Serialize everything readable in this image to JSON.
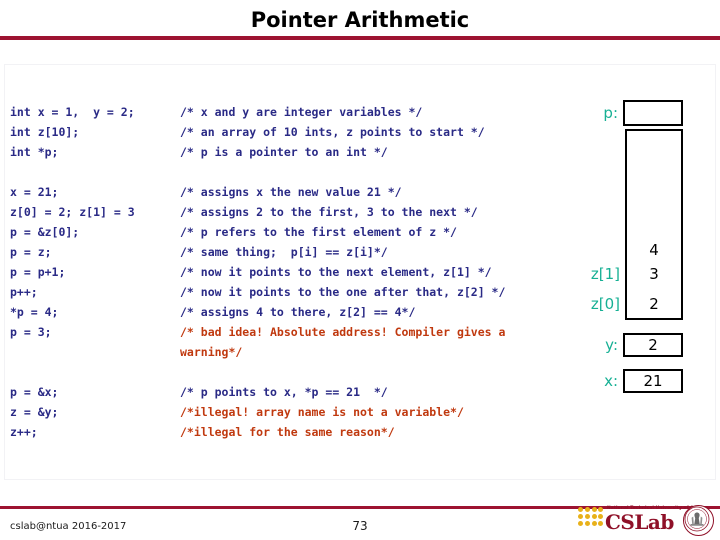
{
  "slide": {
    "title": "Pointer Arithmetic",
    "accent_color": "#9d1331",
    "code_color": "#2a2a86",
    "warning_color": "#c0390f",
    "label_color": "#17b094"
  },
  "code": {
    "lines": [
      {
        "stmt": "int x = 1,  y = 2;",
        "comment": "/* x and y are integer variables */",
        "warn": false
      },
      {
        "stmt": "int z[10];",
        "comment": "/* an array of 10 ints, z points to start */",
        "warn": false
      },
      {
        "stmt": "int *p;",
        "comment": "/* p is a pointer to an int */",
        "warn": false
      },
      {
        "stmt": "",
        "comment": "",
        "warn": false
      },
      {
        "stmt": "x = 21;",
        "comment": "/* assigns x the new value 21 */",
        "warn": false
      },
      {
        "stmt": "z[0] = 2; z[1] = 3",
        "comment": "/* assigns 2 to the first, 3 to the next */",
        "warn": false
      },
      {
        "stmt": "p = &z[0];",
        "comment": "/* p refers to the first element of z */",
        "warn": false
      },
      {
        "stmt": "p = z;",
        "comment": "/* same thing;  p[i] == z[i]*/",
        "warn": false
      },
      {
        "stmt": "p = p+1;",
        "comment": "/* now it points to the next element, z[1] */",
        "warn": false
      },
      {
        "stmt": "p++;",
        "comment": "/* now it points to the one after that, z[2] */",
        "warn": false
      },
      {
        "stmt": "*p = 4;",
        "comment": "/* assigns 4 to there, z[2] == 4*/",
        "warn": false
      },
      {
        "stmt": "p = 3;",
        "comment": "/* bad idea! Absolute address! Compiler gives a",
        "warn": true
      },
      {
        "stmt": "",
        "comment": "warning*/",
        "warn": true,
        "continuation": true
      },
      {
        "stmt": "",
        "comment": "",
        "warn": false
      },
      {
        "stmt": "p = &x;",
        "comment": "/* p points to x, *p == 21  */",
        "warn": false
      },
      {
        "stmt": "z = &y;",
        "comment": "/*illegal! array name is not a variable*/",
        "warn": true
      },
      {
        "stmt": "z++;",
        "comment": "/*illegal for the same reason*/",
        "warn": true
      }
    ]
  },
  "diagram": {
    "pointer_label": "p:",
    "pointer_value": "",
    "array_labels": {
      "z1": "z[1]",
      "z0": "z[0]"
    },
    "array_values": {
      "z2": "4",
      "z1": "3",
      "z0": "2"
    },
    "y_label": "y:",
    "y_value": "2",
    "x_label": "x:",
    "x_value": "21"
  },
  "footer": {
    "credit": "cslab@ntua 2016-2017",
    "page": "73"
  },
  "logo": {
    "university": "National Technical University of Athens",
    "wordmark": "CSLab"
  }
}
